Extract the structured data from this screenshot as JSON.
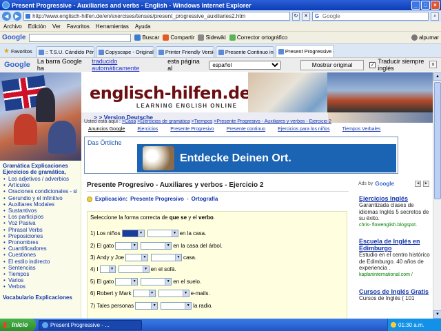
{
  "window": {
    "title": "Present Progressive - Auxiliaries and verbs - English - Windows Internet Explorer",
    "controls": [
      "_",
      "□",
      "×"
    ]
  },
  "address_bar": {
    "url": "http://www.englisch-hilfen.de/en/exercises/tenses/present_progressive_auxiliaries2.htm",
    "search_placeholder": "Google"
  },
  "menu": [
    "Archivo",
    "Edición",
    "Ver",
    "Favoritos",
    "Herramientas",
    "Ayuda"
  ],
  "google_toolbar": {
    "logo": "Google",
    "items": [
      "Buscar",
      "Compartir",
      "Sidewiki",
      "Corrector ortográfico"
    ],
    "user": "alpumar"
  },
  "tabs": {
    "favorites_label": "Favoritos",
    "items": [
      {
        "label": ":: T.S.U. Cándido Pérez ::"
      },
      {
        "label": "Copyscape - Original Conte..."
      },
      {
        "label": "Printer Friendly Version hel..."
      },
      {
        "label": "Presente Continuo inglés"
      },
      {
        "label": "Present Progressive - A..."
      }
    ]
  },
  "translate_bar": {
    "logo": "Google",
    "text_before": "La barra Google ha",
    "link": "traducido automáticamente",
    "text_after": "esta página al",
    "language": "español",
    "show_original": "Mostrar original",
    "always_translate": "Traducir siempre inglés"
  },
  "site": {
    "logo": "englisch-hilfen.de",
    "tagline": "LEARNING ENGLISH ONLINE",
    "version_link": "> > Version Deutsche",
    "breadcrumb": {
      "label": "Usted está aquí :",
      "items": [
        ">Casa",
        ">Ejercicios de gramática",
        ">Tiempos",
        ">Presente Progresivo - Auxiliares y verbos - Ejercicio 2"
      ]
    },
    "nav": [
      "Anuncios Google",
      "Ejercicios",
      "Presente Progresivo",
      "Presente continuo",
      "Ejercicios para los niños",
      "Tiempos Verbales"
    ]
  },
  "ad_banner": {
    "title": "Das Örtliche",
    "text": "Entdecke Deinen Ort."
  },
  "sidebar": {
    "heading": "Gramática Explicaciones Ejercicios de gramática,",
    "items": [
      "Los adjetivos / adverbios",
      "Artículos",
      "Oraciones condicionales - si",
      "Gerundio y el infinitivo",
      "Auxiliares Modales",
      "Sustantivos",
      "Los participios",
      "Voz Pasiva",
      "Phrasal Verbs",
      "Preposiciones",
      "Pronombres",
      "Cuantificadores",
      "Cuestiones",
      "El estilo indirecto",
      "Sentencias",
      "Tiempos",
      "Varios",
      "Verbos"
    ],
    "heading2": "Vocabulario Explicaciones"
  },
  "exercise": {
    "title": "Presente Progresivo - Auxiliares y verbos - Ejercicio 2",
    "explanation_label": "Explicación:",
    "explanation_link": "Presente Progresivo",
    "separator": "-",
    "spelling_link": "Ortografía",
    "instruction_before": "Seleccione la forma correcta de",
    "instruction_be": "que se",
    "instruction_mid": "y el",
    "instruction_verb": "verbo",
    "instruction_end": ".",
    "rows": [
      {
        "n": "1)",
        "subject": "Los niños",
        "rest": "en la casa."
      },
      {
        "n": "2)",
        "subject": "El gato",
        "rest": "en la casa del árbol."
      },
      {
        "n": "3)",
        "subject": "Andy y Joe",
        "rest": "casa."
      },
      {
        "n": "4)",
        "subject": "I",
        "rest": "en el sofá."
      },
      {
        "n": "5)",
        "subject": "El gato",
        "rest": "en el suelo."
      },
      {
        "n": "6)",
        "subject": "Robert y Mark",
        "rest": "e-mails."
      },
      {
        "n": "7)",
        "subject": "Tales personas",
        "rest": "la radio."
      }
    ]
  },
  "right_ads": {
    "ads_by": "Ads by",
    "ads_by_logo": "Google",
    "items": [
      {
        "title": "Ejercicios Inglés",
        "desc": "Garantizada clases de idiomas Inglés 5 secretos de su éxito.",
        "url": "chris- flowenglish.blogspot."
      },
      {
        "title": "Escuela de Inglés en Edimburgo",
        "desc": "Estudio en el centro histórico de Edimburgo. 40 años de experiencia .",
        "url": "kaplaninternational.com /"
      },
      {
        "title": "Cursos de Inglés Gratis",
        "desc": "Cursos de Inglés ( 101",
        "url": ""
      }
    ]
  },
  "taskbar": {
    "start": "Inicio",
    "task": "Present Progressive - ...",
    "clock": "01:30 a.m."
  }
}
